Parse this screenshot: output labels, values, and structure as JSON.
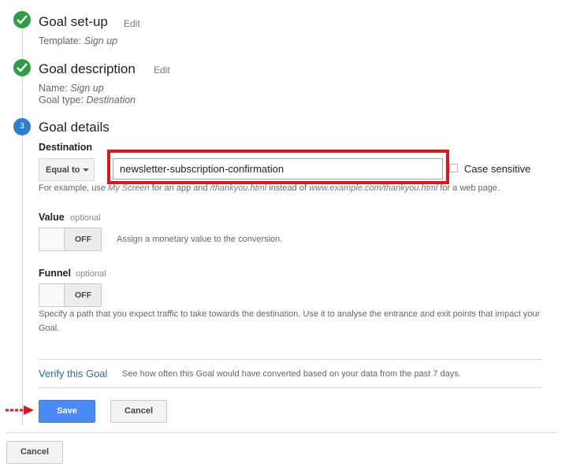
{
  "steps": [
    {
      "title": "Goal set-up",
      "edit_label": "Edit",
      "status": "complete",
      "details": [
        {
          "label": "Template:",
          "value": "Sign up"
        }
      ]
    },
    {
      "title": "Goal description",
      "edit_label": "Edit",
      "status": "complete",
      "details": [
        {
          "label": "Name:",
          "value": "Sign up"
        },
        {
          "label": "Goal type:",
          "value": "Destination"
        }
      ]
    },
    {
      "title": "Goal details",
      "number": "3",
      "status": "current"
    }
  ],
  "destination": {
    "label": "Destination",
    "match_type": "Equal to",
    "value": "newsletter-subscription-confirmation",
    "case_sensitive_label": "Case sensitive",
    "case_sensitive_checked": false,
    "hint_prefix": "For example, use",
    "hint_example_app": "My Screen",
    "hint_middle": "for an app and",
    "hint_example_page": "/thankyou.html",
    "hint_instead": "instead of",
    "hint_example_full": "www.example.com/thankyou.html",
    "hint_suffix": "for a web page."
  },
  "value_field": {
    "label": "Value",
    "optional": "optional",
    "toggle": "OFF",
    "description": "Assign a monetary value to the conversion."
  },
  "funnel_field": {
    "label": "Funnel",
    "optional": "optional",
    "toggle": "OFF",
    "description": "Specify a path that you expect traffic to take towards the destination. Use it to analyse the entrance and exit points that impact your Goal."
  },
  "verify": {
    "link": "Verify this Goal",
    "description": "See how often this Goal would have converted based on your data from the past 7 days."
  },
  "actions": {
    "save": "Save",
    "cancel": "Cancel",
    "outer_cancel": "Cancel"
  },
  "colors": {
    "check_green": "#2e9e44",
    "step_blue": "#2c7fcf",
    "highlight_red": "#e0141b",
    "primary_blue": "#4a8af4",
    "link_blue": "#2c6ab3"
  }
}
